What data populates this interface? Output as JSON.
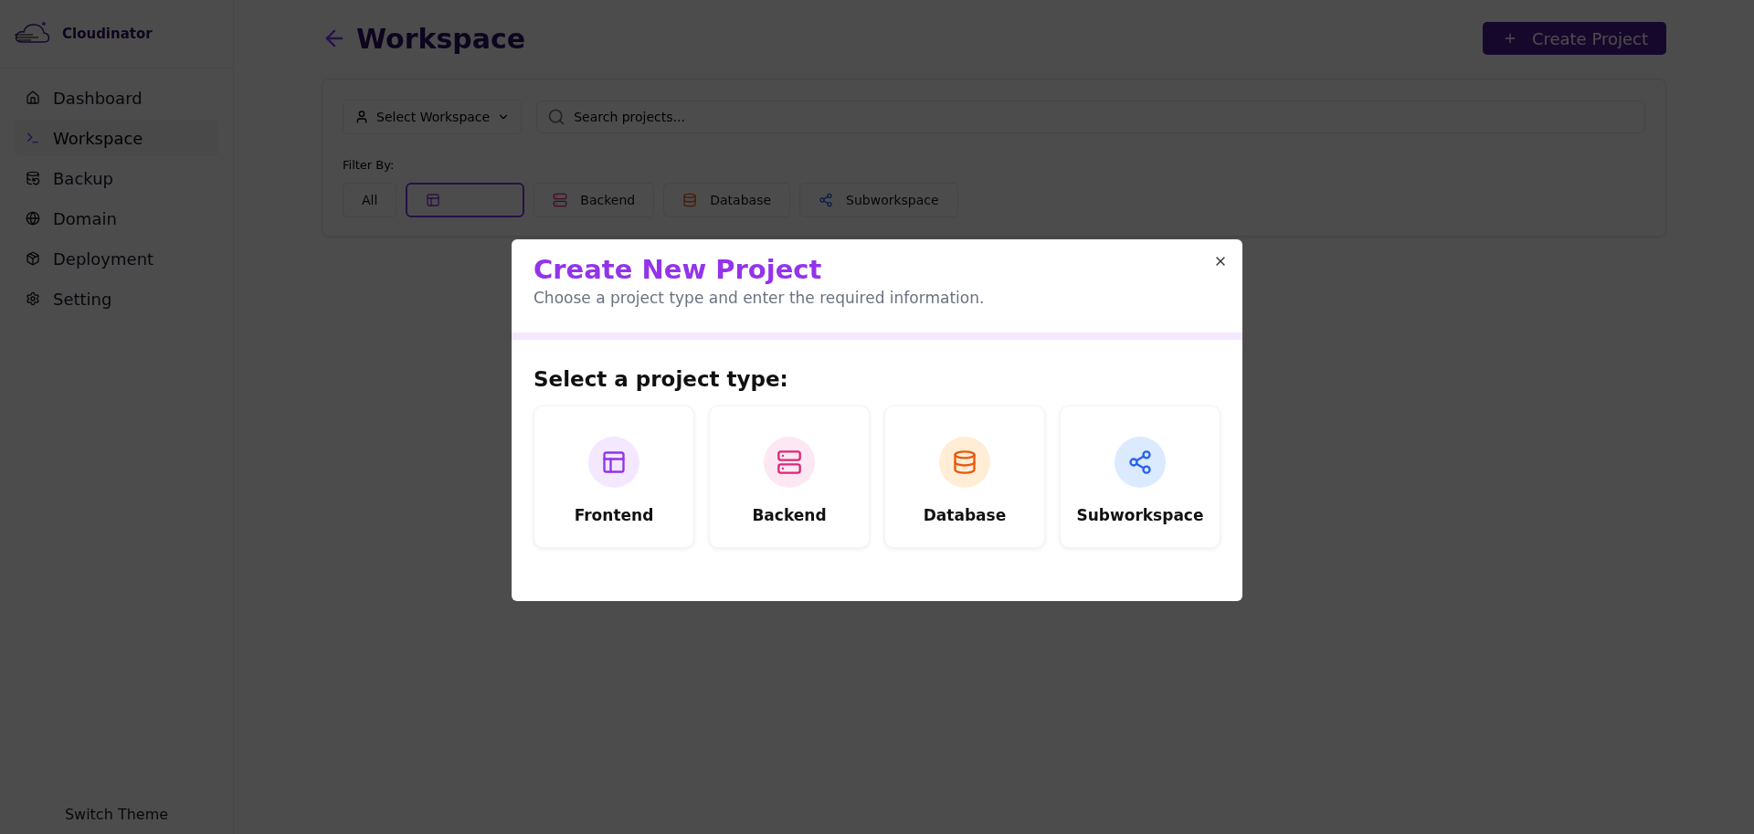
{
  "brand": {
    "name": "Cloudinator"
  },
  "sidebar": {
    "items": [
      {
        "label": "Dashboard",
        "selected": false
      },
      {
        "label": "Workspace",
        "selected": true
      },
      {
        "label": "Backup",
        "selected": false
      },
      {
        "label": "Domain",
        "selected": false
      },
      {
        "label": "Deployment",
        "selected": false
      },
      {
        "label": "Setting",
        "selected": false
      }
    ],
    "footer": "Switch Theme"
  },
  "header": {
    "title": "Workspace",
    "create_button": "Create Project"
  },
  "toolbar": {
    "workspace_select": "Select Workspace",
    "search": {
      "placeholder": "Search projects..."
    },
    "filter_label": "Filter By:",
    "filters": [
      {
        "kind": "text",
        "label": "All",
        "selected": false
      },
      {
        "kind": "frontend",
        "selected": true
      },
      {
        "kind": "backend",
        "label": "Backend",
        "selected": false
      },
      {
        "kind": "database",
        "label": "Database",
        "selected": false
      },
      {
        "kind": "subworkspace",
        "label": "Subworkspace",
        "selected": false
      }
    ]
  },
  "modal": {
    "title": "Create New Project",
    "subtitle": "Choose a project type and enter the required information.",
    "section_title": "Select a project type:",
    "types": [
      {
        "kind": "frontend",
        "label": "Frontend"
      },
      {
        "kind": "backend",
        "label": "Backend"
      },
      {
        "kind": "database",
        "label": "Database"
      },
      {
        "kind": "subworkspace",
        "label": "Subworkspace"
      }
    ]
  }
}
